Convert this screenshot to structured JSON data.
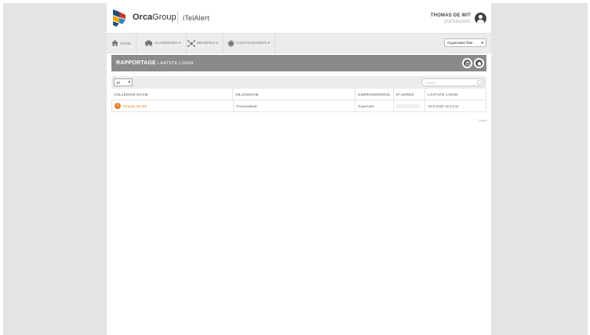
{
  "header": {
    "brand_bold": "Orca",
    "brand_rest": "Group",
    "app_name": "iTelAlert",
    "user_name": "THOMAS DE WIT",
    "user_role": "(SUPERUSER)",
    "logo_colors": [
      "#1f4e79",
      "#c0392b",
      "#f0a500",
      "#2e86c1"
    ]
  },
  "nav": {
    "items": [
      {
        "label": "HOME",
        "icon": "home-icon"
      },
      {
        "label": "ALARMEREN ▾",
        "icon": "car-icon"
      },
      {
        "label": "BEHEREN ▾",
        "icon": "network-icon"
      },
      {
        "label": "CONFIGUREREN ▾",
        "icon": "gear-icon"
      }
    ],
    "org_filter": "Organisatie filter"
  },
  "report": {
    "title": "RAPPORTAGE",
    "subtitle": "LAATSTE LOGIN",
    "buttons": [
      "export-icon",
      "home-icon"
    ]
  },
  "table": {
    "page_length": "10",
    "search_placeholder": "Zoeken",
    "columns": [
      "VOLLEDIGE NAAM",
      "INLOGNAAM",
      "GEBRUIKERSROL",
      "IP ADRES",
      "LAATSTE LOGIN"
    ],
    "rows": [
      {
        "name": "Thomas De Wit",
        "login": "Thomasdewit",
        "role": "Superuser",
        "ip": "",
        "last_login": "15-5-2025 15:14:42"
      }
    ],
    "pager": "1 item",
    "accent": "#e8812b"
  }
}
